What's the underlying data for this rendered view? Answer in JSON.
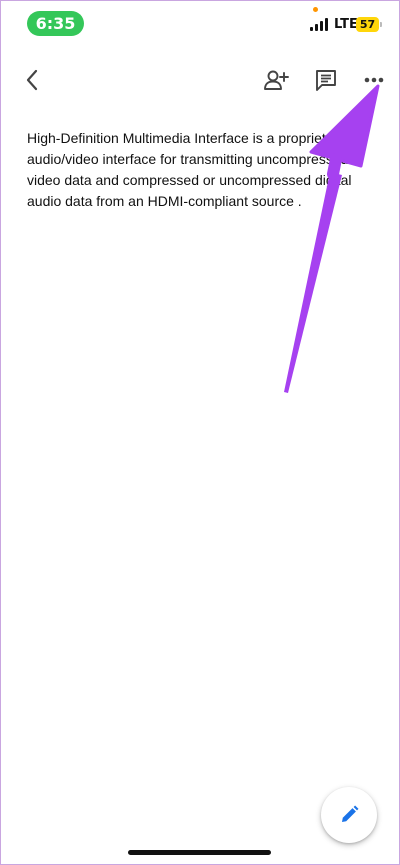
{
  "status_bar": {
    "time": "6:35",
    "network": "LTE",
    "battery": "57",
    "time_pill_color": "#34c759",
    "battery_color": "#ffd60a"
  },
  "toolbar": {
    "back_icon": "chevron-left-icon",
    "share_icon": "add-person-icon",
    "comment_icon": "comment-icon",
    "more_icon": "more-horizontal-icon"
  },
  "document": {
    "body": "High-Definition Multimedia Interface is a proprietary audio/video interface for transmitting uncompressed video data and compressed or uncompressed digital audio data from an HDMI-compliant source ."
  },
  "annotation": {
    "arrow_color": "#a641f0"
  },
  "fab": {
    "icon": "pencil-icon",
    "icon_color": "#1a73e8"
  }
}
